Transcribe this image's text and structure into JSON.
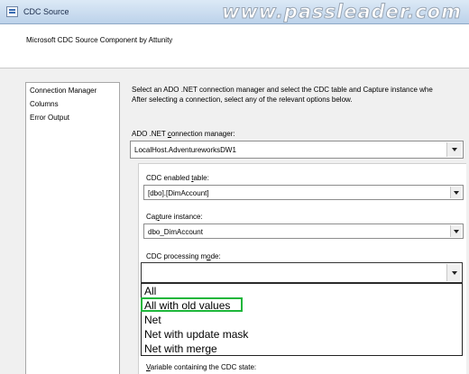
{
  "window": {
    "title": "CDC Source",
    "watermark": "www.passleader.com"
  },
  "header": {
    "text": "Microsoft CDC Source Component by Attunity"
  },
  "nav": {
    "items": [
      "Connection Manager",
      "Columns",
      "Error Output"
    ]
  },
  "instructions": {
    "line1": "Select an ADO .NET connection manager and select the CDC table and Capture instance whe",
    "line2": "After selecting a connection, select any of the relevant options below."
  },
  "connection_manager": {
    "label_pre": "ADO .NET ",
    "label_key": "c",
    "label_post": "onnection manager:",
    "value": "LocalHost.AdventureworksDW1"
  },
  "cdc_table": {
    "label_pre": "CDC enabled ",
    "label_key": "t",
    "label_post": "able:",
    "value": "[dbo].[DimAccount]"
  },
  "capture_instance": {
    "label_pre": "Ca",
    "label_key": "p",
    "label_post": "ture instance:",
    "value": "dbo_DimAccount"
  },
  "processing_mode": {
    "label_pre": "CDC processing m",
    "label_key": "o",
    "label_post": "de:",
    "value": "",
    "options": [
      "All",
      "All with old values",
      "Net",
      "Net with update mask",
      "Net with merge"
    ],
    "highlighted": "All with old values"
  },
  "state_variable": {
    "label_pre": "",
    "label_key": "V",
    "label_post": "ariable containing the CDC state:"
  },
  "colors": {
    "titlebar_top": "#dce9f6",
    "dialog_bg": "#f0f0f0",
    "highlight_border": "#1db63a"
  }
}
